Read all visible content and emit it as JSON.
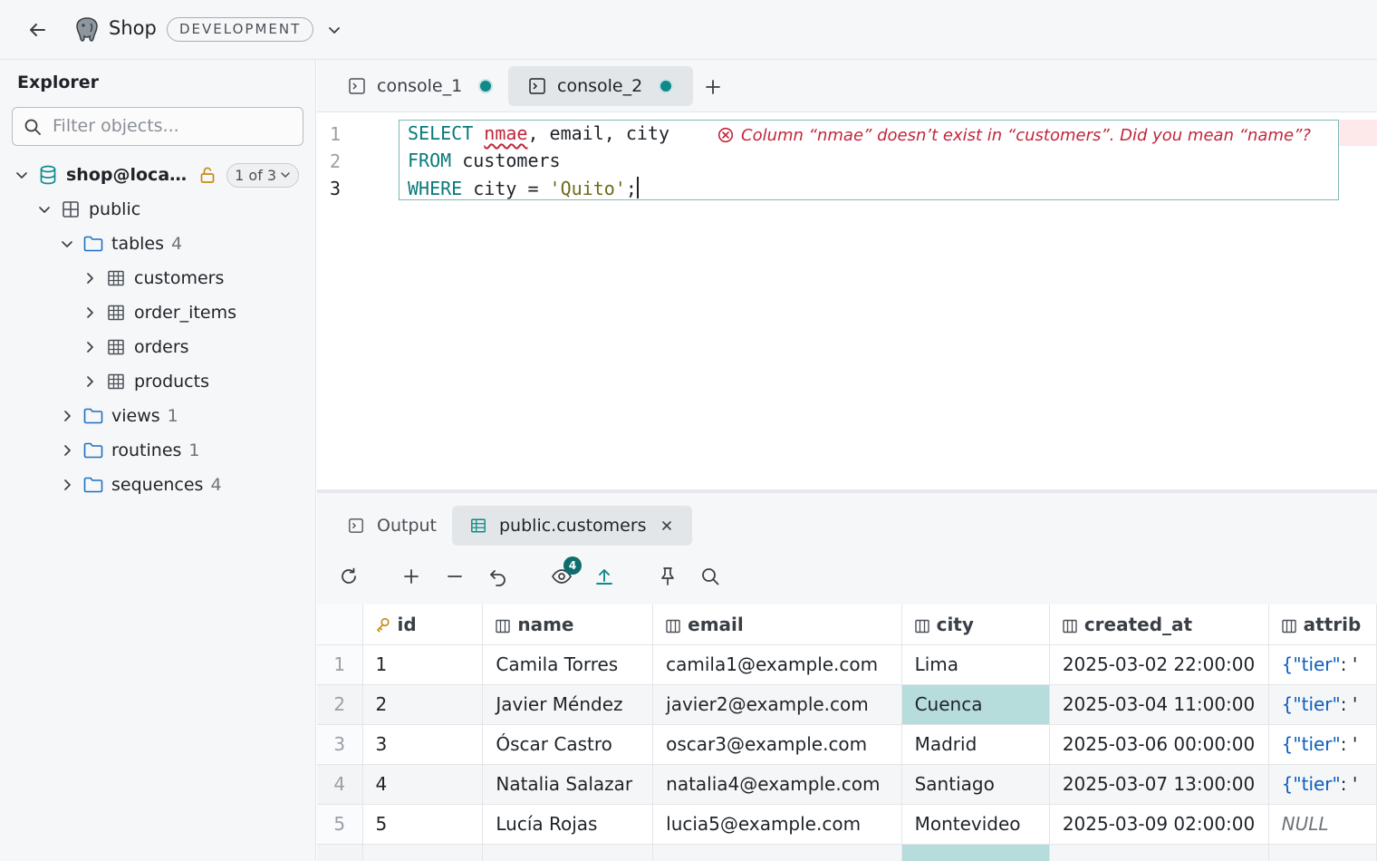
{
  "topbar": {
    "back_icon": "arrow-left-icon",
    "logo_icon": "postgres-elephant-icon",
    "project_name": "Shop",
    "environment": "DEVELOPMENT"
  },
  "explorer": {
    "title": "Explorer",
    "filter_placeholder": "Filter objects...",
    "connection": {
      "name": "shop@loca…",
      "of_badge": "1 of 3"
    },
    "schema": "public",
    "tables_folder": {
      "label": "tables",
      "count": "4"
    },
    "tables": [
      "customers",
      "order_items",
      "orders",
      "products"
    ],
    "folders": [
      {
        "label": "views",
        "count": "1"
      },
      {
        "label": "routines",
        "count": "1"
      },
      {
        "label": "sequences",
        "count": "4"
      }
    ]
  },
  "editor": {
    "tabs": [
      {
        "label": "console_1",
        "active": false
      },
      {
        "label": "console_2",
        "active": true
      }
    ],
    "line_numbers": [
      "1",
      "2",
      "3"
    ],
    "lines": {
      "l1_kw": "SELECT",
      "l1_err": "nmae",
      "l1_rest": ", email, city",
      "l2_kw": "FROM",
      "l2_rest": " customers",
      "l3_kw": "WHERE",
      "l3_mid": " city = ",
      "l3_str": "'Quito'",
      "l3_end": ";"
    },
    "error_message": "Column “nmae” doesn’t exist in “customers”. Did you mean “name”?"
  },
  "results": {
    "tabs": [
      {
        "label": "Output",
        "active": false
      },
      {
        "label": "public.customers",
        "active": true
      }
    ],
    "hidden_columns_badge": "4",
    "columns": [
      "id",
      "name",
      "email",
      "city",
      "created_at",
      "attrib"
    ],
    "rows": [
      {
        "n": "1",
        "id": "1",
        "name": "Camila Torres",
        "email": "camila1@example.com",
        "city": "Lima",
        "created_at": "2025-03-02 22:00:00",
        "attr_key": "{\"tier\"",
        "attr_rest": ": '"
      },
      {
        "n": "2",
        "id": "2",
        "name": "Javier Méndez",
        "email": "javier2@example.com",
        "city": "Cuenca",
        "created_at": "2025-03-04 11:00:00",
        "attr_key": "{\"tier\"",
        "attr_rest": ": '"
      },
      {
        "n": "3",
        "id": "3",
        "name": "Óscar Castro",
        "email": "oscar3@example.com",
        "city": "Madrid",
        "created_at": "2025-03-06 00:00:00",
        "attr_key": "{\"tier\"",
        "attr_rest": ": '"
      },
      {
        "n": "4",
        "id": "4",
        "name": "Natalia Salazar",
        "email": "natalia4@example.com",
        "city": "Santiago",
        "created_at": "2025-03-07 13:00:00",
        "attr_key": "{\"tier\"",
        "attr_rest": ": '"
      },
      {
        "n": "5",
        "id": "5",
        "name": "Lucía Rojas",
        "email": "lucia5@example.com",
        "city": "Montevideo",
        "created_at": "2025-03-09 02:00:00",
        "attr_null": "NULL"
      }
    ],
    "accent": "#0e8a8a",
    "selected_cell_color": "#b7dcdc"
  }
}
